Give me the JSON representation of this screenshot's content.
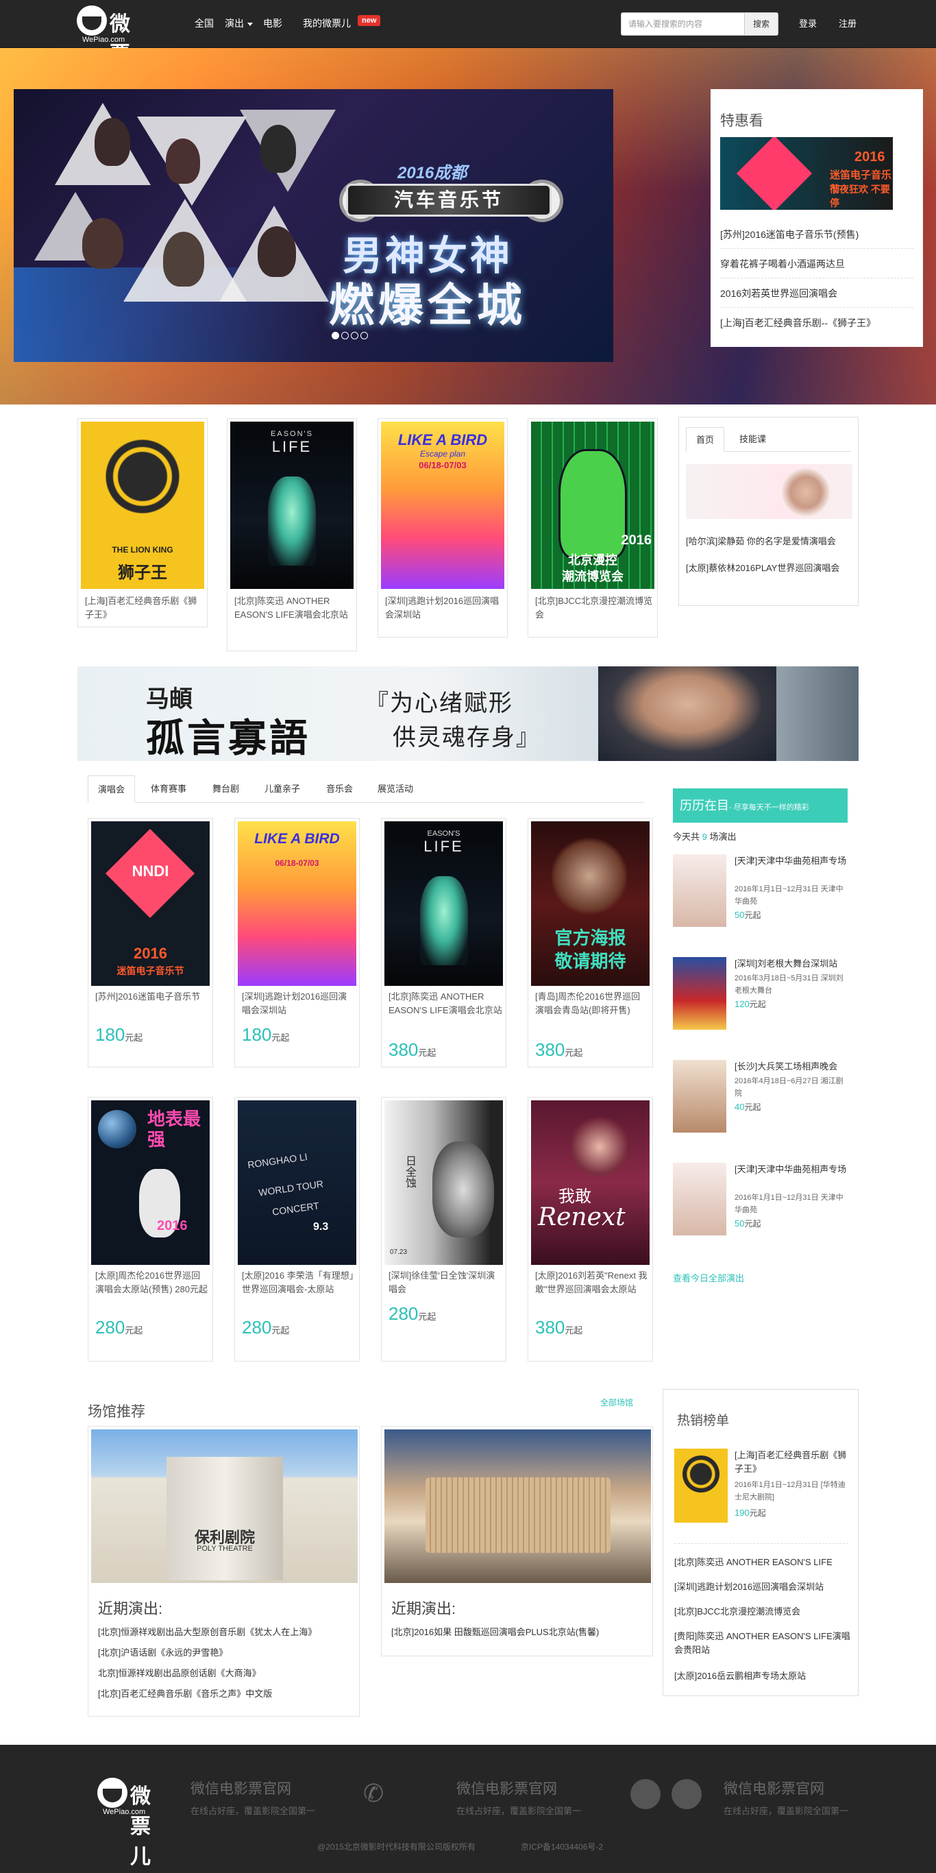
{
  "header": {
    "logo_text": "微票儿",
    "logo_domain": "WePiao.com",
    "nav": [
      "全国",
      "演出",
      "电影",
      "我的微票儿"
    ],
    "new_badge": "new",
    "search_placeholder": "请输入要搜索的内容",
    "search_button": "搜索",
    "login": "登录",
    "register": "注册"
  },
  "hero": {
    "year_city": "2016成都",
    "festival": "汽车音乐节",
    "headline1": "男神女神",
    "headline2": "燃爆全城",
    "dots_count": 4,
    "active_dot": 0
  },
  "special": {
    "title": "特惠看",
    "promo_year": "2016",
    "promo_title": "迷笛电子音乐节",
    "promo_sub": "彻夜狂欢 不要停",
    "items": [
      "[苏州]2016迷笛电子音乐节(预售)",
      "穿着花裤子喝着小酒逼两达旦",
      "2016刘若英世界巡回演唱会",
      "[上海]百老汇经典音乐剧--《狮子王》"
    ]
  },
  "row1": {
    "cards": [
      {
        "caption": "[上海]百老汇经典音乐剧《狮子王》"
      },
      {
        "caption": "[北京]陈奕迅 ANOTHER EASON'S LIFE演唱会北京站"
      },
      {
        "caption": "[深圳]逃跑计划2016巡回演唱会深圳站"
      },
      {
        "caption": "[北京]BJCC北京漫控潮流博览会"
      }
    ],
    "poster_text": {
      "lion_en": "THE LION KING",
      "lion_cn": "狮子王",
      "eason_en": "EASON'S",
      "eason_life": "LIFE",
      "bird": "LIKE A BIRD",
      "bird_sub": "Escape plan",
      "bird_dates": "06/18-07/03",
      "bjcc_year": "2016",
      "bjcc_cn": "北京漫控",
      "bjcc_cn2": "潮流博览会"
    },
    "tabs": [
      "首页",
      "技能课"
    ],
    "tab_lines": [
      "[哈尔滨]梁静茹 你的名字是爱情演唱会",
      "[太原]蔡依林2016PLAY世界巡回演唱会"
    ]
  },
  "banner": {
    "line1": "马頔",
    "line2": "孤言寡語",
    "line3": "『为心绪赋形",
    "line4": "供灵魂存身』"
  },
  "categories": [
    "演唱会",
    "体育赛事",
    "舞台剧",
    "儿童亲子",
    "音乐会",
    "展览活动"
  ],
  "shows": [
    {
      "title": "[苏州]2016迷笛电子音乐节",
      "price": "180",
      "unit": "元起"
    },
    {
      "title": "[深圳]逃跑计划2016巡回演唱会深圳站",
      "price": "180",
      "unit": "元起"
    },
    {
      "title": "[北京]陈奕迅 ANOTHER EASON'S LIFE演唱会北京站",
      "price": "380",
      "unit": "元起"
    },
    {
      "title": "[青岛]周杰伦2016世界巡回演唱会青岛站(即将开售)",
      "price": "380",
      "unit": "元起"
    },
    {
      "title": "[太原]周杰伦2016世界巡回演唱会太原站(预售) 280元起",
      "price": "280",
      "unit": "元起"
    },
    {
      "title": "[太原]2016 李荣浩「有理想」世界巡回演唱会-太原站",
      "price": "280",
      "unit": "元起"
    },
    {
      "title": "[深圳]徐佳莹'日全蚀'深圳演唱会",
      "price": "280",
      "unit": "元起"
    },
    {
      "title": "[太原]2016刘若英\"Renext 我敢\"世界巡回演唱会太原站",
      "price": "380",
      "unit": "元起"
    }
  ],
  "show_poster_text": {
    "nndi": "NNDI",
    "nndi_year": "2016",
    "nndi_cn": "迷笛电子音乐节",
    "jay_slogan": "官方海报",
    "jay_slogan2": "敬请期待",
    "jay2_cn": "地表最强",
    "jay2_year": "2016",
    "ronghao": "RONGHAO LI",
    "ronghao2": "WORLD TOUR",
    "ronghao3": "CONCERT",
    "ronghao_date": "9.3",
    "eclipse_cn": "日全蚀",
    "eclipse_date": "07.23",
    "renext": "Renext",
    "renext_cn": "我敢"
  },
  "today": {
    "title": "历历在目",
    "subtitle": "- 尽享每天不一样的精彩",
    "count_prefix": "今天共",
    "count": "9",
    "count_suffix": "场演出",
    "items": [
      {
        "title": "[天津]天津中华曲苑相声专场",
        "date": "2016年1月1日~12月31日 天津中华曲苑",
        "price": "50",
        "unit": "元起"
      },
      {
        "title": "[深圳]刘老根大舞台深圳站",
        "date": "2016年3月18日~5月31日 深圳刘老根大舞台",
        "price": "120",
        "unit": "元起"
      },
      {
        "title": "[长沙]大兵笑工场相声晚会",
        "date": "2016年4月18日~6月27日 湘江剧院",
        "price": "40",
        "unit": "元起"
      },
      {
        "title": "[天津]天津中华曲苑相声专场",
        "date": "2016年1月1日~12月31日 天津中华曲苑",
        "price": "50",
        "unit": "元起"
      }
    ],
    "more": "查看今日全部演出"
  },
  "venues": {
    "title": "场馆推荐",
    "all_link": "全部场馆",
    "cards": [
      {
        "sign": "保利剧院",
        "sign_en": "POLY THEATRE",
        "heading": "近期演出:",
        "lines": [
          "[北京]恒源祥戏剧出品大型原创音乐剧《犹太人在上海》",
          "[北京]沪语话剧《永远的尹雪艳》",
          "北京]恒源祥戏剧出品原创话剧《大商海》",
          "[北京]百老汇经典音乐剧《音乐之声》中文版"
        ]
      },
      {
        "heading": "近期演出:",
        "lines": [
          "[北京]2016如果 田馥甄巡回演唱会PLUS北京站(售馨)"
        ]
      }
    ]
  },
  "hotlist": {
    "title": "热销榜单",
    "top": {
      "title": "[上海]百老汇经典音乐剧《狮子王》",
      "date": "2016年1月1日~12月31日 [华特迪士尼大剧院]",
      "price": "190",
      "unit": "元起"
    },
    "lines": [
      "[北京]陈奕迅 ANOTHER EASON'S LIFE",
      "[深圳]逃跑计划2016巡回演唱会深圳站",
      "[北京]BJCC北京漫控潮流博览会",
      "[贵阳]陈奕迅 ANOTHER EASON'S LIFE演唱会贵阳站",
      "[太原]2016岳云鹏相声专场太原站"
    ]
  },
  "footer": {
    "cols": [
      {
        "title": "微信电影票官网",
        "sub": "在线占好座，覆盖影院全国第一"
      },
      {
        "title": "微信电影票官网",
        "sub": "在线占好座，覆盖影院全国第一"
      },
      {
        "title": "微信电影票官网",
        "sub": "在线占好座，覆盖影院全国第一"
      }
    ],
    "copyright": "@2015北京微影时代科技有限公司版权所有",
    "icp": "京ICP备14034406号-2"
  }
}
